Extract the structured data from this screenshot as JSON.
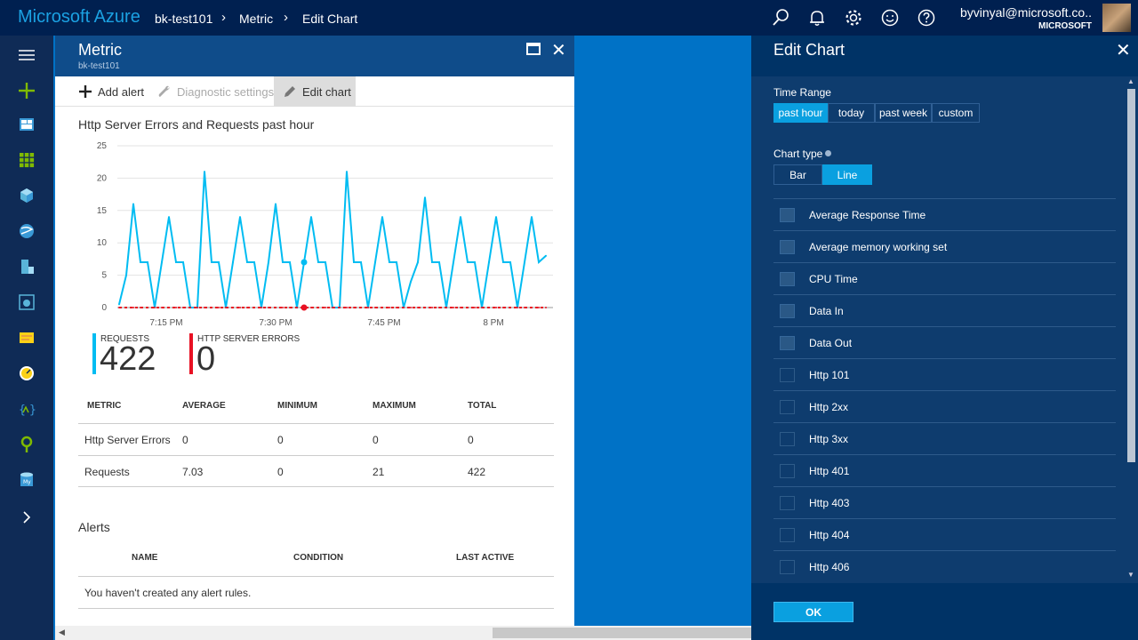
{
  "topbar": {
    "brand": "Microsoft Azure",
    "breadcrumbs": [
      "bk-test101",
      "Metric",
      "Edit Chart"
    ],
    "user_name": "byvinyal@microsoft.co..",
    "user_org": "MICROSOFT"
  },
  "metric_blade": {
    "title": "Metric",
    "subtitle": "bk-test101",
    "commands": {
      "add_alert": "Add alert",
      "diagnostic_settings": "Diagnostic settings",
      "edit_chart": "Edit chart"
    },
    "chart_title": "Http Server Errors and Requests past hour",
    "kpis": [
      {
        "label": "REQUESTS",
        "value": "422",
        "color": "#00bcf2"
      },
      {
        "label": "HTTP SERVER ERRORS",
        "value": "0",
        "color": "#e81123"
      }
    ],
    "table": {
      "headers": [
        "METRIC",
        "AVERAGE",
        "MINIMUM",
        "MAXIMUM",
        "TOTAL"
      ],
      "rows": [
        [
          "Http Server Errors",
          "0",
          "0",
          "0",
          "0"
        ],
        [
          "Requests",
          "7.03",
          "0",
          "21",
          "422"
        ]
      ]
    },
    "alerts": {
      "title": "Alerts",
      "headers": [
        "NAME",
        "CONDITION",
        "LAST ACTIVE"
      ],
      "empty_text": "You haven't created any alert rules."
    }
  },
  "chart_data": {
    "type": "line",
    "y_ticks": [
      "0",
      "5",
      "10",
      "15",
      "20",
      "25"
    ],
    "ylim": [
      0,
      25
    ],
    "x_ticks": [
      "7:15 PM",
      "7:30 PM",
      "7:45 PM",
      "8 PM"
    ],
    "grid": true,
    "series": [
      {
        "name": "Requests",
        "color": "#00bcf2",
        "values": [
          0.5,
          5,
          16,
          7,
          7,
          0,
          7,
          14,
          7,
          7,
          0,
          0,
          21,
          7,
          7,
          0,
          7,
          14,
          7,
          7,
          0,
          7,
          16,
          7,
          7,
          0,
          7,
          14,
          7,
          7,
          0,
          0,
          21,
          7,
          7,
          0,
          7,
          14,
          7,
          7,
          0,
          4,
          7,
          17,
          7,
          7,
          0,
          7,
          14,
          7,
          7,
          0,
          7,
          14,
          7,
          7,
          0,
          7,
          14,
          7,
          8
        ]
      },
      {
        "name": "Http Server Errors",
        "color": "#e81123",
        "values": [
          0,
          0,
          0,
          0,
          0,
          0,
          0,
          0,
          0,
          0,
          0,
          0,
          0,
          0,
          0,
          0,
          0,
          0,
          0,
          0,
          0,
          0,
          0,
          0,
          0,
          0,
          0,
          0,
          0,
          0,
          0,
          0,
          0,
          0,
          0,
          0,
          0,
          0,
          0,
          0,
          0,
          0,
          0,
          0,
          0,
          0,
          0,
          0,
          0,
          0,
          0,
          0,
          0,
          0,
          0,
          0,
          0,
          0,
          0,
          0,
          0
        ]
      }
    ]
  },
  "edit_blade": {
    "title": "Edit Chart",
    "time_range_label": "Time Range",
    "time_range_options": [
      "past hour",
      "today",
      "past week",
      "custom"
    ],
    "time_range_selected": "past hour",
    "chart_type_label": "Chart type",
    "chart_type_options": [
      "Bar",
      "Line"
    ],
    "chart_type_selected": "Line",
    "metrics": [
      "Average Response Time",
      "Average memory working set",
      "CPU Time",
      "Data In",
      "Data Out",
      "Http 101",
      "Http 2xx",
      "Http 3xx",
      "Http 401",
      "Http 403",
      "Http 404",
      "Http 406"
    ],
    "ok_label": "OK"
  },
  "colors": {
    "azure_blue": "#0072c6",
    "topbar": "#002050",
    "accent": "#0aa0e0",
    "requests": "#00bcf2",
    "errors": "#e81123"
  }
}
